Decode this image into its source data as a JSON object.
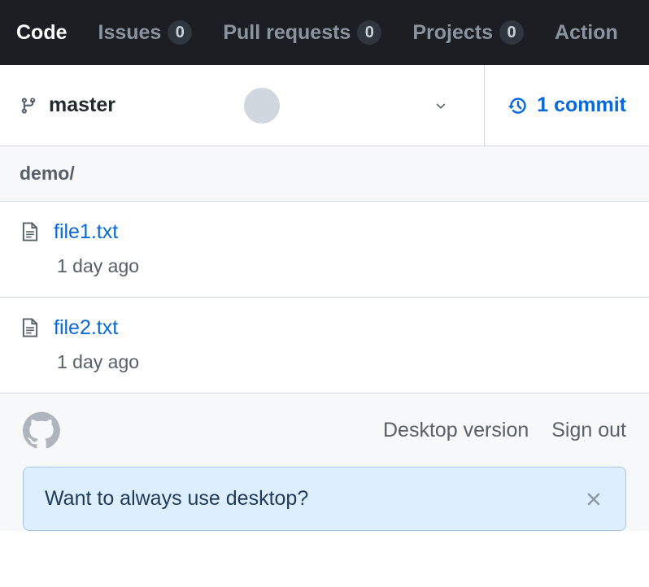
{
  "nav": {
    "tabs": [
      {
        "label": "Code",
        "active": true
      },
      {
        "label": "Issues",
        "count": "0"
      },
      {
        "label": "Pull requests",
        "count": "0"
      },
      {
        "label": "Projects",
        "count": "0"
      },
      {
        "label": "Action"
      }
    ]
  },
  "branch": {
    "name": "master",
    "commits_label": "1 commit"
  },
  "path": "demo/",
  "files": [
    {
      "name": "file1.txt",
      "time": "1 day ago"
    },
    {
      "name": "file2.txt",
      "time": "1 day ago"
    }
  ],
  "footer": {
    "desktop_link": "Desktop version",
    "signout_link": "Sign out"
  },
  "banner": {
    "message": "Want to always use desktop?"
  }
}
